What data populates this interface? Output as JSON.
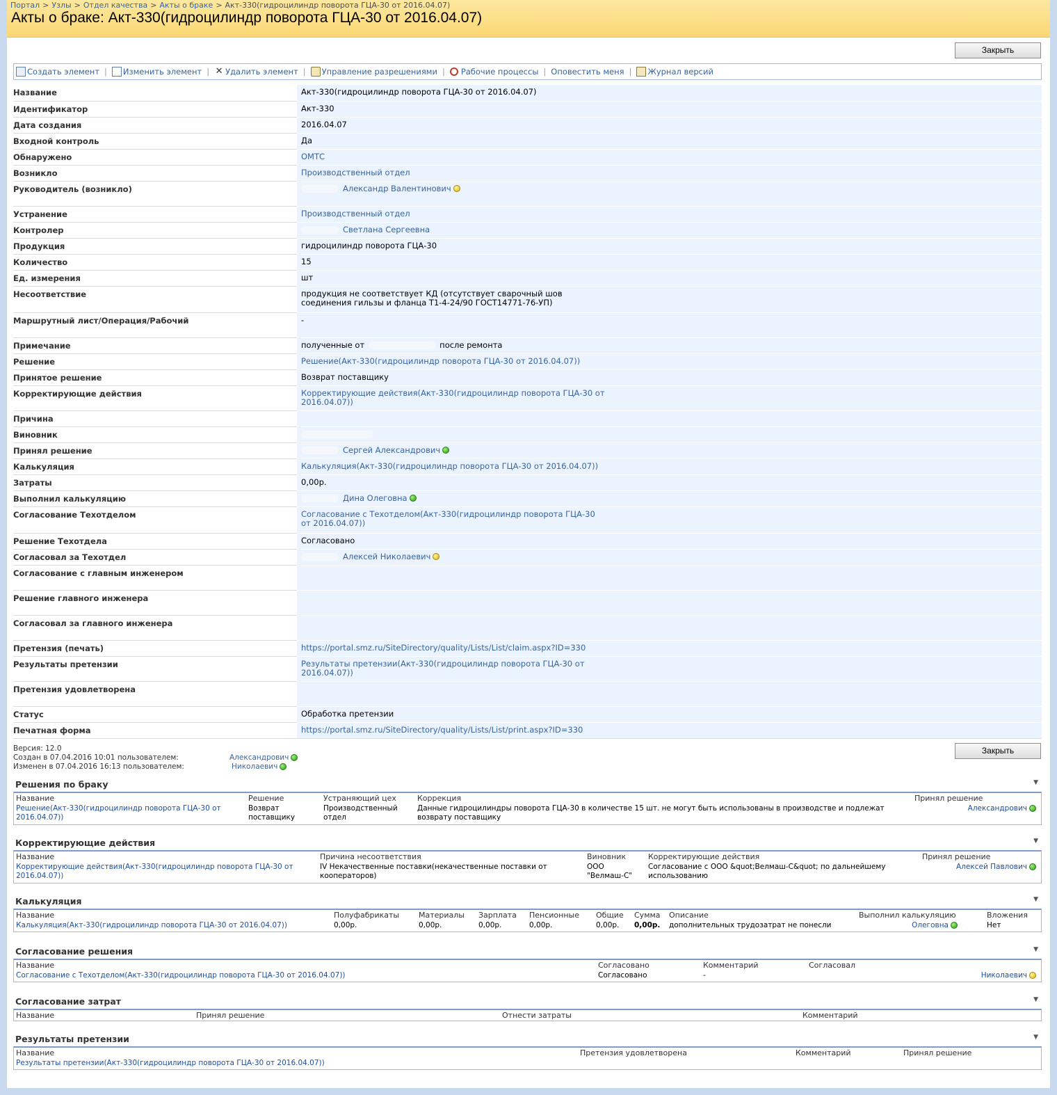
{
  "breadcrumb": [
    "Портал",
    "Узлы",
    "Отдел качества",
    "Акты о браке",
    "Акт-330(гидроцилиндр поворота ГЦА-30 от 2016.04.07)"
  ],
  "page_title": "Акты о браке: Акт-330(гидроцилиндр поворота ГЦА-30 от 2016.04.07)",
  "close_label": "Закрыть",
  "toolbar": [
    {
      "label": "Создать элемент",
      "icon": "new-item-icon"
    },
    {
      "label": "Изменить элемент",
      "icon": "edit-item-icon"
    },
    {
      "label": "Удалить элемент",
      "icon": "delete-icon"
    },
    {
      "label": "Управление разрешениями",
      "icon": "permissions-icon"
    },
    {
      "label": "Рабочие процессы",
      "icon": "workflow-icon"
    },
    {
      "label": "Оповестить меня",
      "icon": ""
    },
    {
      "label": "Журнал версий",
      "icon": "version-history-icon"
    }
  ],
  "fields": [
    {
      "label": "Название",
      "value": "Акт-330(гидроцилиндр поворота ГЦА-30  от 2016.04.07)",
      "kind": "text"
    },
    {
      "label": "Идентификатор",
      "value": "Акт-330",
      "kind": "text"
    },
    {
      "label": "Дата создания",
      "value": "2016.04.07",
      "kind": "text"
    },
    {
      "label": "Входной контроль",
      "value": "Да",
      "kind": "text"
    },
    {
      "label": "Обнаружено",
      "value": "ОМТС",
      "kind": "link"
    },
    {
      "label": "Возникло",
      "value": "Производственный отдел",
      "kind": "link"
    },
    {
      "label": "Руководитель (возникло)",
      "value": "Александр Валентинович",
      "kind": "user",
      "presence": "yellow"
    },
    {
      "label": "Устранение",
      "value": "Производственный отдел",
      "kind": "link"
    },
    {
      "label": "Контролер",
      "value": "Светлана Сергеевна",
      "kind": "user",
      "presence": ""
    },
    {
      "label": "Продукция",
      "value": "гидроцилиндр поворота ГЦА-30",
      "kind": "text"
    },
    {
      "label": "Количество",
      "value": "15",
      "kind": "text"
    },
    {
      "label": "Ед. измерения",
      "value": "шт",
      "kind": "text"
    },
    {
      "label": "Несоответствие",
      "value": "продукция не соответствует КД (отсутствует сварочный шов соединения гильзы и фланца Т1-4-24/90 ГОСТ14771-76-УП)",
      "kind": "text"
    },
    {
      "label": "Маршрутный лист/Операция/Рабочий",
      "value": "-",
      "kind": "text"
    },
    {
      "label": "Примечание",
      "value": "полученные от",
      "value2": "после ремонта",
      "kind": "note"
    },
    {
      "label": "Решение",
      "value": "Решение(Акт-330(гидроцилиндр поворота ГЦА-30 от 2016.04.07))",
      "kind": "link"
    },
    {
      "label": "Принятое решение",
      "value": "Возврат поставщику",
      "kind": "text"
    },
    {
      "label": "Корректирующие действия",
      "value": "Корректирующие действия(Акт-330(гидроцилиндр поворота ГЦА-30 от 2016.04.07))",
      "kind": "link"
    },
    {
      "label": "Причина",
      "value": "",
      "kind": "text"
    },
    {
      "label": "Виновник",
      "value": "",
      "kind": "hidden"
    },
    {
      "label": "Принял решение",
      "value": "Сергей Александрович",
      "kind": "user",
      "presence": "green"
    },
    {
      "label": "Калькуляция",
      "value": "Калькуляция(Акт-330(гидроцилиндр поворота ГЦА-30 от 2016.04.07))",
      "kind": "link"
    },
    {
      "label": "Затраты",
      "value": "0,00р.",
      "kind": "text"
    },
    {
      "label": "Выполнил калькуляцию",
      "value": "Дина Олеговна",
      "kind": "user",
      "presence": "green"
    },
    {
      "label": "Согласование Техотделом",
      "value": "Согласование с Техотделом(Акт-330(гидроцилиндр поворота ГЦА-30 от 2016.04.07))",
      "kind": "link"
    },
    {
      "label": "Решение Техотдела",
      "value": "Согласовано",
      "kind": "text"
    },
    {
      "label": "Согласовал за Техотдел",
      "value": "Алексей Николаевич",
      "kind": "user",
      "presence": "yellow"
    },
    {
      "label": "Согласование с главным инженером",
      "value": "",
      "kind": "text"
    },
    {
      "label": "Решение главного инженера",
      "value": "",
      "kind": "text"
    },
    {
      "label": "Согласовал за главного инженера",
      "value": "",
      "kind": "text"
    },
    {
      "label": "Претензия (печать)",
      "value": "https://portal.smz.ru/SiteDirectory/quality/Lists/List/claim.aspx?ID=330",
      "kind": "link"
    },
    {
      "label": "Результаты претензии",
      "value": "Результаты претензии(Акт-330(гидроцилиндр поворота ГЦА-30 от 2016.04.07))",
      "kind": "link"
    },
    {
      "label": "Претензия удовлетворена",
      "value": "",
      "kind": "text"
    },
    {
      "label": "Статус",
      "value": "Обработка претензии",
      "kind": "text"
    },
    {
      "label": "Печатная форма",
      "value": "https://portal.smz.ru/SiteDirectory/quality/Lists/List/print.aspx?ID=330",
      "kind": "link"
    }
  ],
  "meta": {
    "version": "Версия: 12.0",
    "created": "Создан в 07.04.2016 10:01  пользователем:",
    "created_by": "Александрович",
    "modified": "Изменен в 07.04.2016 16:13  пользователем:",
    "modified_by": "Николаевич"
  },
  "sections": [
    {
      "title": "Решения по браку",
      "columns": [
        "Название",
        "Решение",
        "Устраняющий цех",
        "Коррекция",
        "Принял решение"
      ],
      "row": [
        "Решение(Акт-330(гидроцилиндр поворота ГЦА-30 от 2016.04.07))",
        "Возврат поставщику",
        "Производственный отдел",
        "Данные гидроцилиндры поворота ГЦА-30 в количестве 15 шт. не могут быть использованы в производстве и подлежат возврату поставщику",
        "Александрович"
      ]
    },
    {
      "title": "Корректирующие действия",
      "columns": [
        "Название",
        "Причина несоответствия",
        "Виновник",
        "Корректирующие действия",
        "Принял решение"
      ],
      "row": [
        "Корректирующие действия(Акт-330(гидроцилиндр поворота ГЦА-30 от 2016.04.07))",
        "IV Некачественные поставки(некачественные поставки от кооператоров)",
        "ООО \"Велмаш-С\"",
        "Согласование с ООО &quot;Велмаш-С&quot; по дальнейшему использованию",
        "Алексей Павлович"
      ]
    },
    {
      "title": "Калькуляция",
      "columns": [
        "Название",
        "Полуфабрикаты",
        "Материалы",
        "Зарплата",
        "Пенсионные",
        "Общие",
        "Сумма",
        "Описание",
        "Выполнил калькуляцию",
        "Вложения"
      ],
      "row": [
        "Калькуляция(Акт-330(гидроцилиндр поворота ГЦА-30 от 2016.04.07))",
        "0,00р.",
        "0,00р.",
        "0,00р.",
        "0,00р.",
        "0,00р.",
        "0,00р.",
        "дополнительных трудозатрат не понесли",
        "Олеговна",
        "Нет"
      ]
    },
    {
      "title": "Согласование решения",
      "columns": [
        "Название",
        "Согласовано",
        "Комментарий",
        "Согласовал"
      ],
      "row": [
        "Согласование с Техотделом(Акт-330(гидроцилиндр поворота ГЦА-30 от 2016.04.07))",
        "Согласовано",
        "-",
        "Николаевич"
      ]
    },
    {
      "title": "Согласование затрат",
      "columns": [
        "Название",
        "Принял решение",
        "Отнести затраты",
        "Комментарий"
      ],
      "row": []
    },
    {
      "title": "Результаты претензии",
      "columns": [
        "Название",
        "Претензия удовлетворена",
        "Комментарий",
        "Принял решение"
      ],
      "row": [
        "Результаты претензии(Акт-330(гидроцилиндр поворота ГЦА-30 от 2016.04.07))",
        "",
        "",
        ""
      ]
    }
  ]
}
